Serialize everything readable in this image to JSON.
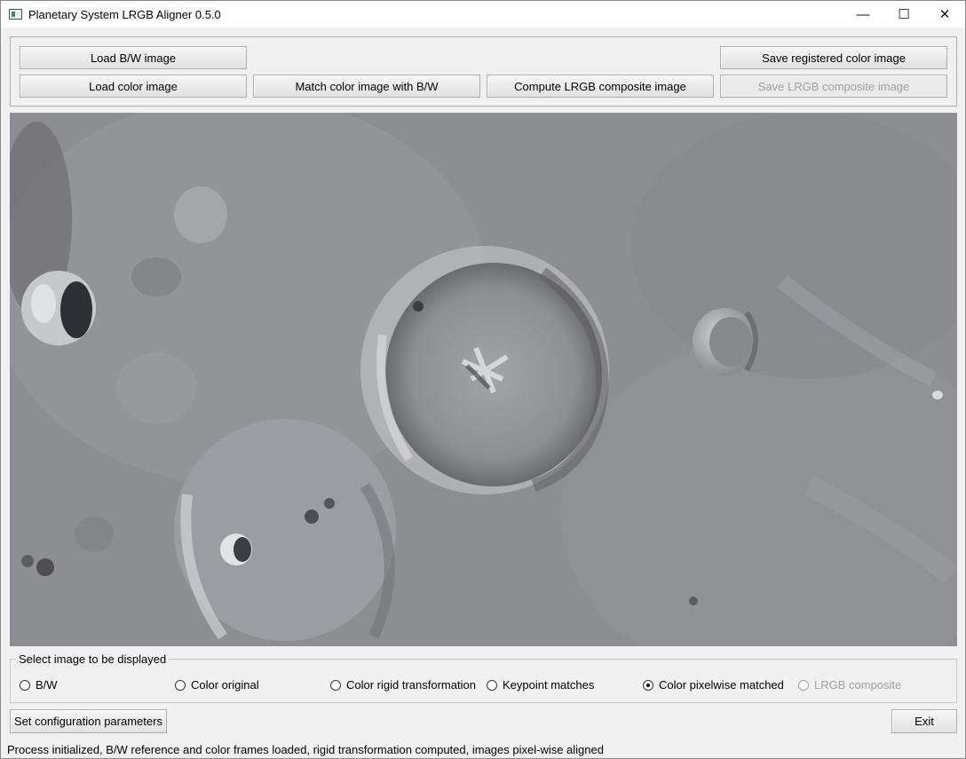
{
  "window": {
    "title": "Planetary System LRGB Aligner 0.5.0"
  },
  "titlebar_buttons": {
    "minimize": "—",
    "maximize": "☐",
    "close": "✕"
  },
  "toolbar": {
    "load_bw": "Load B/W image",
    "load_color": "Load color image",
    "match_color": "Match color image with B/W",
    "compute_lrgb": "Compute LRGB composite image",
    "save_registered": "Save registered color image",
    "save_lrgb": "Save LRGB composite image"
  },
  "display_selector": {
    "title": "Select image to be displayed",
    "options": [
      {
        "label": "B/W",
        "checked": false,
        "enabled": true
      },
      {
        "label": "Color original",
        "checked": false,
        "enabled": true
      },
      {
        "label": "Color rigid transformation",
        "checked": false,
        "enabled": true
      },
      {
        "label": "Keypoint matches",
        "checked": false,
        "enabled": true
      },
      {
        "label": "Color pixelwise matched",
        "checked": true,
        "enabled": true
      },
      {
        "label": "LRGB composite",
        "checked": false,
        "enabled": false
      }
    ]
  },
  "bottom_buttons": {
    "config": "Set configuration parameters",
    "exit": "Exit"
  },
  "status": "Process initialized, B/W reference and color frames loaded, rigid transformation computed, images pixel-wise aligned"
}
